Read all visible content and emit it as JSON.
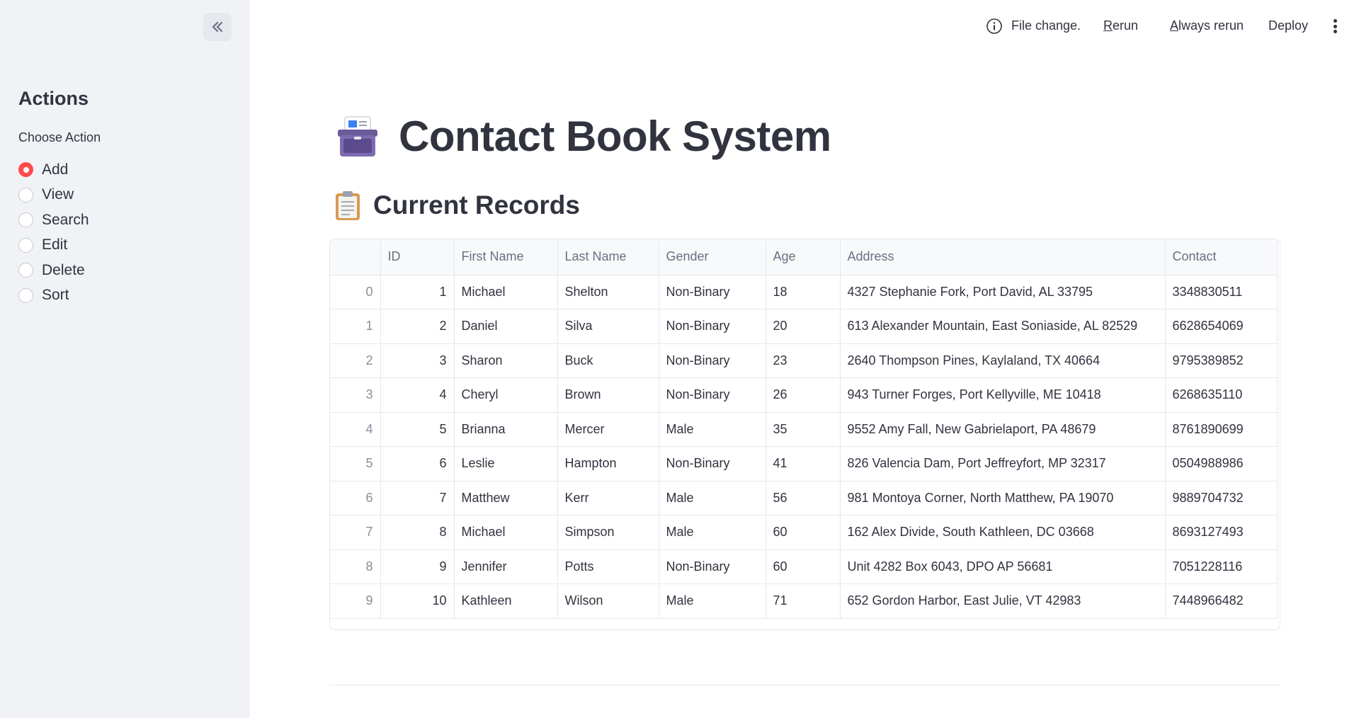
{
  "header": {
    "status_text": "File change.",
    "rerun_prefix": "",
    "rerun_underline": "R",
    "rerun_rest": "erun",
    "always_underline": "A",
    "always_rest": "lways rerun",
    "deploy_label": "Deploy",
    "info_icon": "info-icon",
    "menu_icon": "kebab-menu-icon"
  },
  "sidebar": {
    "collapse_icon": "double-chevron-left-icon",
    "heading": "Actions",
    "radio_label": "Choose Action",
    "options": [
      "Add",
      "View",
      "Search",
      "Edit",
      "Delete",
      "Sort"
    ],
    "selected": "Add"
  },
  "main": {
    "title": "Contact Book System",
    "title_icon": "card-file-box-icon",
    "subtitle": "Current Records",
    "subtitle_icon": "clipboard-icon"
  },
  "table": {
    "columns": [
      "",
      "ID",
      "First Name",
      "Last Name",
      "Gender",
      "Age",
      "Address",
      "Contact"
    ],
    "rows": [
      [
        "0",
        "1",
        "Michael",
        "Shelton",
        "Non-Binary",
        "18",
        "4327 Stephanie Fork, Port David, AL 33795",
        "3348830511"
      ],
      [
        "1",
        "2",
        "Daniel",
        "Silva",
        "Non-Binary",
        "20",
        "613 Alexander Mountain, East Soniaside, AL 82529",
        "6628654069"
      ],
      [
        "2",
        "3",
        "Sharon",
        "Buck",
        "Non-Binary",
        "23",
        "2640 Thompson Pines, Kaylaland, TX 40664",
        "9795389852"
      ],
      [
        "3",
        "4",
        "Cheryl",
        "Brown",
        "Non-Binary",
        "26",
        "943 Turner Forges, Port Kellyville, ME 10418",
        "6268635110"
      ],
      [
        "4",
        "5",
        "Brianna",
        "Mercer",
        "Male",
        "35",
        "9552 Amy Fall, New Gabrielaport, PA 48679",
        "8761890699"
      ],
      [
        "5",
        "6",
        "Leslie",
        "Hampton",
        "Non-Binary",
        "41",
        "826 Valencia Dam, Port Jeffreyfort, MP 32317",
        "0504988986"
      ],
      [
        "6",
        "7",
        "Matthew",
        "Kerr",
        "Male",
        "56",
        "981 Montoya Corner, North Matthew, PA 19070",
        "9889704732"
      ],
      [
        "7",
        "8",
        "Michael",
        "Simpson",
        "Male",
        "60",
        "162 Alex Divide, South Kathleen, DC 03668",
        "8693127493"
      ],
      [
        "8",
        "9",
        "Jennifer",
        "Potts",
        "Non-Binary",
        "60",
        "Unit 4282 Box 6043, DPO AP 56681",
        "7051228116"
      ],
      [
        "9",
        "10",
        "Kathleen",
        "Wilson",
        "Male",
        "71",
        "652 Gordon Harbor, East Julie, VT 42983",
        "7448966482"
      ]
    ]
  },
  "colors": {
    "accent": "#ff4b4b",
    "sidebar_bg": "#f0f2f6",
    "text": "#31333f"
  }
}
